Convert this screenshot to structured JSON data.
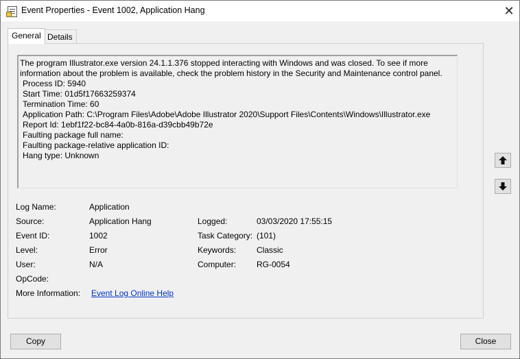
{
  "window": {
    "title": "Event Properties - Event 1002, Application Hang",
    "close_glyph": "✕"
  },
  "tabs": [
    {
      "label": "General"
    },
    {
      "label": "Details"
    }
  ],
  "description": {
    "lines": [
      "The program Illustrator.exe version 24.1.1.376 stopped interacting with Windows and was closed. To see if more",
      "information about the problem is available, check the problem history in the Security and Maintenance control panel.",
      "Process ID: 5940",
      "Start Time: 01d5f17663259374",
      "Termination Time: 60",
      "Application Path: C:\\Program Files\\Adobe\\Adobe Illustrator 2020\\Support Files\\Contents\\Windows\\Illustrator.exe",
      "Report Id: 1ebf1f22-bc84-4a0b-816a-d39cbb49b72e",
      "Faulting package full name:",
      "Faulting package-relative application ID:",
      "Hang type: Unknown"
    ]
  },
  "fields": {
    "log_name": {
      "label": "Log Name:",
      "value": "Application"
    },
    "source": {
      "label": "Source:",
      "value": "Application Hang"
    },
    "logged": {
      "label": "Logged:",
      "value": "03/03/2020 17:55:15"
    },
    "event_id": {
      "label": "Event ID:",
      "value": "1002"
    },
    "task_category": {
      "label": "Task Category:",
      "value": "(101)"
    },
    "level": {
      "label": "Level:",
      "value": "Error"
    },
    "keywords": {
      "label": "Keywords:",
      "value": "Classic"
    },
    "user": {
      "label": "User:",
      "value": "N/A"
    },
    "computer": {
      "label": "Computer:",
      "value": "RG-0054"
    },
    "opcode": {
      "label": "OpCode:",
      "value": ""
    },
    "more_info": {
      "label": "More Information:",
      "value": "Event Log Online Help"
    }
  },
  "buttons": {
    "copy": "Copy",
    "close": "Close"
  },
  "icons": {
    "window": "event-properties-icon",
    "up": "arrow-up-icon",
    "down": "arrow-down-icon"
  }
}
